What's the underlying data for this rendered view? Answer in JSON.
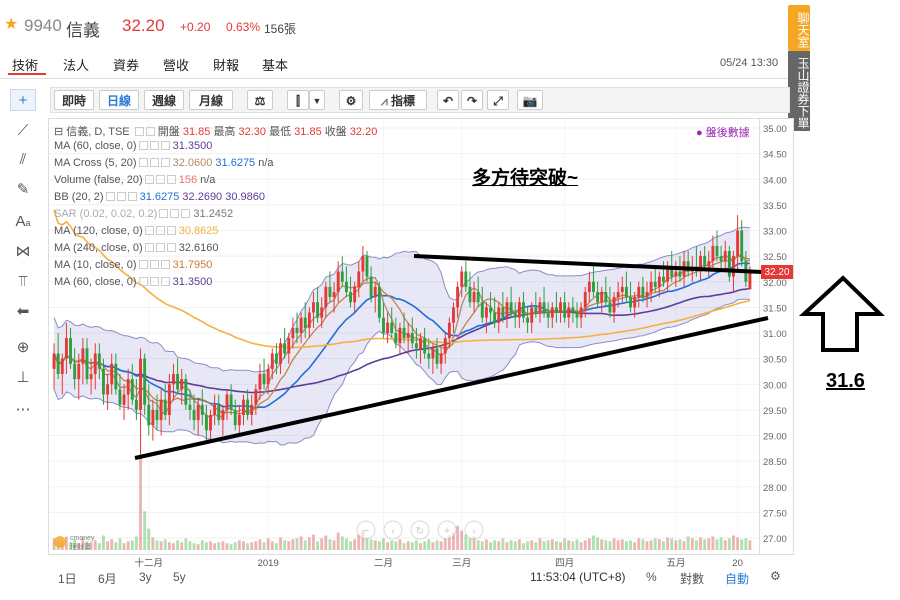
{
  "header": {
    "star": "★",
    "code": "9940",
    "name": "信義",
    "price": "32.20",
    "change": "+0.20",
    "change_pct": "0.63%",
    "volume": "156張"
  },
  "nav": {
    "tabs": [
      "技術",
      "法人",
      "資券",
      "營收",
      "財報",
      "基本"
    ],
    "datetime": "05/24 13:30"
  },
  "side": {
    "chat": "聊天室",
    "stock_label": "玉山證券下單"
  },
  "toolbar": {
    "intraday": "即時",
    "daily": "日線",
    "weekly": "週線",
    "monthly": "月線",
    "indicators": "指標"
  },
  "legend": {
    "ohlc_title": "信義, D, TSE",
    "open_label": "開盤",
    "open": "31.85",
    "high_label": "最高",
    "high": "32.30",
    "low_label": "最低",
    "low": "31.85",
    "close_label": "收盤",
    "close": "32.20",
    "after_hours": "盤後數據",
    "rows": [
      {
        "name": "MA (60, close, 0)",
        "values": [
          "31.3500"
        ]
      },
      {
        "name": "MA Cross (5, 20)",
        "values": [
          "32.0600",
          "31.6275",
          "n/a"
        ]
      },
      {
        "name": "Volume (false, 20)",
        "values": [
          "156",
          "n/a"
        ]
      },
      {
        "name": "BB (20, 2)",
        "values": [
          "31.6275",
          "32.2690",
          "30.9860"
        ]
      },
      {
        "name": "SAR (0.02, 0.02, 0.2)",
        "values": [
          "31.2452"
        ]
      },
      {
        "name": "MA (120, close, 0)",
        "values": [
          "30.8625"
        ]
      },
      {
        "name": "MA (240, close, 0)",
        "values": [
          "32.6160"
        ]
      },
      {
        "name": "MA (10, close, 0)",
        "values": [
          "31.7950"
        ]
      },
      {
        "name": "MA (60, close, 0)",
        "values": [
          "31.3500"
        ]
      }
    ]
  },
  "annotation": {
    "title": "多方待突破~",
    "target": "31.6"
  },
  "bottom": {
    "ranges": [
      "1日",
      "6月",
      "3y",
      "5y"
    ],
    "clock": "11:53:04 (UTC+8)",
    "pct": "%",
    "log": "對數",
    "auto": "自動"
  },
  "chart_data": {
    "type": "candlestick",
    "ylim": [
      26.5,
      35.0
    ],
    "yticks": [
      "35.00",
      "34.50",
      "34.00",
      "33.50",
      "33.00",
      "32.50",
      "32.00",
      "31.50",
      "31.00",
      "30.50",
      "30.00",
      "29.50",
      "29.00",
      "28.50",
      "28.00",
      "27.50",
      "27.00"
    ],
    "xticks": [
      "十二月",
      "2019",
      "二月",
      "三月",
      "四月",
      "五月",
      "20"
    ],
    "xtick_index": [
      23,
      52,
      80,
      99,
      124,
      151,
      166
    ],
    "last_price_tag": "32.20",
    "candles": [
      [
        30.3,
        30.8,
        29.9,
        30.6
      ],
      [
        30.6,
        31.0,
        30.1,
        30.2
      ],
      [
        30.2,
        30.6,
        29.8,
        30.5
      ],
      [
        30.5,
        31.2,
        30.2,
        30.9
      ],
      [
        30.9,
        31.1,
        30.3,
        30.4
      ],
      [
        30.4,
        30.7,
        29.9,
        30.1
      ],
      [
        30.1,
        30.6,
        29.7,
        30.4
      ],
      [
        30.4,
        30.9,
        30.0,
        30.7
      ],
      [
        30.7,
        30.9,
        30.0,
        30.1
      ],
      [
        30.1,
        30.5,
        29.8,
        30.2
      ],
      [
        30.2,
        30.8,
        29.9,
        30.6
      ],
      [
        30.6,
        30.8,
        30.1,
        30.3
      ],
      [
        30.3,
        30.5,
        29.6,
        29.8
      ],
      [
        29.8,
        30.2,
        29.5,
        30.0
      ],
      [
        30.0,
        30.6,
        29.8,
        30.4
      ],
      [
        30.4,
        30.6,
        29.8,
        29.9
      ],
      [
        29.9,
        30.2,
        29.5,
        29.6
      ],
      [
        29.6,
        30.0,
        29.3,
        29.8
      ],
      [
        29.8,
        30.3,
        29.5,
        30.1
      ],
      [
        30.1,
        30.4,
        29.6,
        29.7
      ],
      [
        29.7,
        30.1,
        29.3,
        29.5
      ],
      [
        29.5,
        30.7,
        28.6,
        30.5
      ],
      [
        30.5,
        30.6,
        29.4,
        29.6
      ],
      [
        29.6,
        30.0,
        29.0,
        29.2
      ],
      [
        29.2,
        29.7,
        28.9,
        29.5
      ],
      [
        29.5,
        29.8,
        29.1,
        29.3
      ],
      [
        29.3,
        29.9,
        29.0,
        29.7
      ],
      [
        29.7,
        30.0,
        29.3,
        29.4
      ],
      [
        29.4,
        30.2,
        29.2,
        30.0
      ],
      [
        30.0,
        30.4,
        29.7,
        30.2
      ],
      [
        30.2,
        30.5,
        29.8,
        29.9
      ],
      [
        29.9,
        30.3,
        29.6,
        30.1
      ],
      [
        30.1,
        30.2,
        29.5,
        29.6
      ],
      [
        29.6,
        29.9,
        29.3,
        29.5
      ],
      [
        29.5,
        29.8,
        29.1,
        29.3
      ],
      [
        29.3,
        29.7,
        29.0,
        29.6
      ],
      [
        29.6,
        29.9,
        29.2,
        29.4
      ],
      [
        29.4,
        29.6,
        28.9,
        29.1
      ],
      [
        29.1,
        29.5,
        28.9,
        29.4
      ],
      [
        29.4,
        29.8,
        29.2,
        29.6
      ],
      [
        29.6,
        29.8,
        29.2,
        29.3
      ],
      [
        29.3,
        29.6,
        29.0,
        29.5
      ],
      [
        29.5,
        29.9,
        29.3,
        29.8
      ],
      [
        29.8,
        30.0,
        29.4,
        29.5
      ],
      [
        29.5,
        29.7,
        29.1,
        29.2
      ],
      [
        29.2,
        29.6,
        29.0,
        29.4
      ],
      [
        29.4,
        29.8,
        29.2,
        29.7
      ],
      [
        29.7,
        29.9,
        29.3,
        29.4
      ],
      [
        29.4,
        29.8,
        29.2,
        29.6
      ],
      [
        29.6,
        30.0,
        29.4,
        29.9
      ],
      [
        29.9,
        30.4,
        29.7,
        30.2
      ],
      [
        30.2,
        30.5,
        29.9,
        30.0
      ],
      [
        30.0,
        30.4,
        29.8,
        30.3
      ],
      [
        30.3,
        30.7,
        30.1,
        30.6
      ],
      [
        30.6,
        30.8,
        30.2,
        30.4
      ],
      [
        30.4,
        30.9,
        30.2,
        30.8
      ],
      [
        30.8,
        31.1,
        30.5,
        30.6
      ],
      [
        30.6,
        31.0,
        30.4,
        30.9
      ],
      [
        30.9,
        31.3,
        30.7,
        31.1
      ],
      [
        31.1,
        31.4,
        30.8,
        31.0
      ],
      [
        31.0,
        31.4,
        30.8,
        31.3
      ],
      [
        31.3,
        31.6,
        30.9,
        31.1
      ],
      [
        31.1,
        31.5,
        30.9,
        31.4
      ],
      [
        31.4,
        31.8,
        31.1,
        31.6
      ],
      [
        31.6,
        31.9,
        31.2,
        31.3
      ],
      [
        31.3,
        31.7,
        31.1,
        31.5
      ],
      [
        31.5,
        32.0,
        31.3,
        31.9
      ],
      [
        31.9,
        32.2,
        31.6,
        31.7
      ],
      [
        31.7,
        32.0,
        31.4,
        31.8
      ],
      [
        31.8,
        32.4,
        31.6,
        32.2
      ],
      [
        32.2,
        32.5,
        31.9,
        32.0
      ],
      [
        32.0,
        32.3,
        31.7,
        31.8
      ],
      [
        31.8,
        32.1,
        31.5,
        31.6
      ],
      [
        31.6,
        32.0,
        31.4,
        31.9
      ],
      [
        31.9,
        32.4,
        31.7,
        32.2
      ],
      [
        32.2,
        32.7,
        32.0,
        32.5
      ],
      [
        32.5,
        32.6,
        32.0,
        32.1
      ],
      [
        32.1,
        32.3,
        31.6,
        31.7
      ],
      [
        31.7,
        32.0,
        31.4,
        31.9
      ],
      [
        31.9,
        32.0,
        31.2,
        31.3
      ],
      [
        31.3,
        31.6,
        30.9,
        31.0
      ],
      [
        31.0,
        31.4,
        30.8,
        31.2
      ],
      [
        31.2,
        31.5,
        30.9,
        31.0
      ],
      [
        31.0,
        31.3,
        30.7,
        30.8
      ],
      [
        30.8,
        31.2,
        30.6,
        31.1
      ],
      [
        31.1,
        31.4,
        30.8,
        30.9
      ],
      [
        30.9,
        31.2,
        30.6,
        31.0
      ],
      [
        31.0,
        31.3,
        30.7,
        30.8
      ],
      [
        30.8,
        31.1,
        30.5,
        30.7
      ],
      [
        30.7,
        31.0,
        30.4,
        30.9
      ],
      [
        30.9,
        31.1,
        30.5,
        30.6
      ],
      [
        30.6,
        30.9,
        30.3,
        30.5
      ],
      [
        30.5,
        30.8,
        30.2,
        30.7
      ],
      [
        30.7,
        30.9,
        30.3,
        30.4
      ],
      [
        30.4,
        30.7,
        30.2,
        30.6
      ],
      [
        30.6,
        31.0,
        30.4,
        30.9
      ],
      [
        30.9,
        31.3,
        30.7,
        31.2
      ],
      [
        31.2,
        31.6,
        31.0,
        31.5
      ],
      [
        31.5,
        32.0,
        31.3,
        31.9
      ],
      [
        31.9,
        32.3,
        31.7,
        32.2
      ],
      [
        32.2,
        32.4,
        31.8,
        31.9
      ],
      [
        31.9,
        32.2,
        31.5,
        31.6
      ],
      [
        31.6,
        32.0,
        31.4,
        31.8
      ],
      [
        31.8,
        32.1,
        31.5,
        31.6
      ],
      [
        31.6,
        31.9,
        31.2,
        31.3
      ],
      [
        31.3,
        31.6,
        31.0,
        31.5
      ],
      [
        31.5,
        31.8,
        31.2,
        31.4
      ],
      [
        31.4,
        31.7,
        31.1,
        31.2
      ],
      [
        31.2,
        31.6,
        31.0,
        31.5
      ],
      [
        31.5,
        31.8,
        31.2,
        31.3
      ],
      [
        31.3,
        31.7,
        31.1,
        31.6
      ],
      [
        31.6,
        31.9,
        31.3,
        31.4
      ],
      [
        31.4,
        31.6,
        31.1,
        31.3
      ],
      [
        31.3,
        31.7,
        31.1,
        31.6
      ],
      [
        31.6,
        31.8,
        31.2,
        31.3
      ],
      [
        31.3,
        31.5,
        31.0,
        31.2
      ],
      [
        31.2,
        31.6,
        31.0,
        31.5
      ],
      [
        31.5,
        31.8,
        31.3,
        31.4
      ],
      [
        31.4,
        31.7,
        31.2,
        31.6
      ],
      [
        31.6,
        31.9,
        31.3,
        31.4
      ],
      [
        31.4,
        31.6,
        31.1,
        31.3
      ],
      [
        31.3,
        31.6,
        31.1,
        31.5
      ],
      [
        31.5,
        31.8,
        31.2,
        31.4
      ],
      [
        31.4,
        31.7,
        31.2,
        31.6
      ],
      [
        31.6,
        31.8,
        31.2,
        31.3
      ],
      [
        31.3,
        31.6,
        31.1,
        31.5
      ],
      [
        31.5,
        31.7,
        31.2,
        31.4
      ],
      [
        31.4,
        31.6,
        31.1,
        31.3
      ],
      [
        31.3,
        31.6,
        31.1,
        31.5
      ],
      [
        31.5,
        31.9,
        31.3,
        31.8
      ],
      [
        31.8,
        32.2,
        31.6,
        32.0
      ],
      [
        32.0,
        32.3,
        31.7,
        31.8
      ],
      [
        31.8,
        32.0,
        31.5,
        31.6
      ],
      [
        31.6,
        31.9,
        31.4,
        31.8
      ],
      [
        31.8,
        32.1,
        31.5,
        31.6
      ],
      [
        31.6,
        31.9,
        31.3,
        31.4
      ],
      [
        31.4,
        31.8,
        31.2,
        31.7
      ],
      [
        31.7,
        32.0,
        31.5,
        31.8
      ],
      [
        31.8,
        32.1,
        31.6,
        31.9
      ],
      [
        31.9,
        32.2,
        31.6,
        31.7
      ],
      [
        31.7,
        32.0,
        31.4,
        31.5
      ],
      [
        31.5,
        31.8,
        31.3,
        31.7
      ],
      [
        31.7,
        32.0,
        31.5,
        31.9
      ],
      [
        31.9,
        32.1,
        31.6,
        31.7
      ],
      [
        31.7,
        32.0,
        31.5,
        31.8
      ],
      [
        31.8,
        32.2,
        31.6,
        32.0
      ],
      [
        32.0,
        32.3,
        31.8,
        31.9
      ],
      [
        31.9,
        32.2,
        31.7,
        32.1
      ],
      [
        32.1,
        32.4,
        31.9,
        32.0
      ],
      [
        32.0,
        32.4,
        31.8,
        32.3
      ],
      [
        32.3,
        32.6,
        32.0,
        32.1
      ],
      [
        32.1,
        32.4,
        31.9,
        32.2
      ],
      [
        32.2,
        32.5,
        32.0,
        32.1
      ],
      [
        32.1,
        32.6,
        31.9,
        32.4
      ],
      [
        32.4,
        32.6,
        32.1,
        32.2
      ],
      [
        32.2,
        32.5,
        32.0,
        32.3
      ],
      [
        32.3,
        32.7,
        32.1,
        32.2
      ],
      [
        32.2,
        32.6,
        32.0,
        32.5
      ],
      [
        32.5,
        32.7,
        32.2,
        32.3
      ],
      [
        32.3,
        32.6,
        32.1,
        32.4
      ],
      [
        32.4,
        32.9,
        32.2,
        32.7
      ],
      [
        32.7,
        33.0,
        32.4,
        32.5
      ],
      [
        32.5,
        32.7,
        32.2,
        32.4
      ],
      [
        32.4,
        32.8,
        32.2,
        32.6
      ],
      [
        32.6,
        32.7,
        32.0,
        32.1
      ],
      [
        32.1,
        32.6,
        31.8,
        32.5
      ],
      [
        32.5,
        33.3,
        32.2,
        33.0
      ],
      [
        33.0,
        33.2,
        32.3,
        32.4
      ],
      [
        32.4,
        32.6,
        31.9,
        32.0
      ],
      [
        31.85,
        32.3,
        31.85,
        32.2
      ]
    ],
    "volumes": [
      12,
      10,
      9,
      14,
      8,
      11,
      7,
      13,
      9,
      8,
      10,
      7,
      15,
      9,
      11,
      8,
      12,
      7,
      9,
      10,
      14,
      95,
      40,
      22,
      13,
      10,
      9,
      11,
      8,
      7,
      10,
      8,
      12,
      9,
      7,
      6,
      10,
      8,
      9,
      7,
      8,
      9,
      7,
      6,
      8,
      10,
      9,
      7,
      8,
      9,
      11,
      8,
      12,
      9,
      7,
      13,
      10,
      9,
      11,
      12,
      14,
      10,
      13,
      16,
      9,
      12,
      15,
      11,
      10,
      18,
      14,
      12,
      9,
      11,
      16,
      20,
      13,
      11,
      10,
      9,
      12,
      8,
      10,
      9,
      11,
      7,
      9,
      8,
      10,
      7,
      9,
      11,
      8,
      10,
      9,
      12,
      15,
      18,
      25,
      20,
      16,
      12,
      14,
      10,
      9,
      11,
      8,
      10,
      9,
      12,
      8,
      10,
      9,
      11,
      7,
      9,
      10,
      8,
      12,
      9,
      10,
      11,
      9,
      8,
      12,
      10,
      9,
      11,
      8,
      10,
      12,
      15,
      13,
      11,
      10,
      9,
      12,
      10,
      11,
      9,
      10,
      8,
      12,
      11,
      9,
      10,
      12,
      11,
      9,
      13,
      12,
      10,
      11,
      9,
      14,
      12,
      10,
      13,
      11,
      12,
      14,
      11,
      13,
      10,
      12,
      15,
      13,
      11,
      12,
      10,
      13,
      17,
      12,
      11,
      10
    ]
  }
}
